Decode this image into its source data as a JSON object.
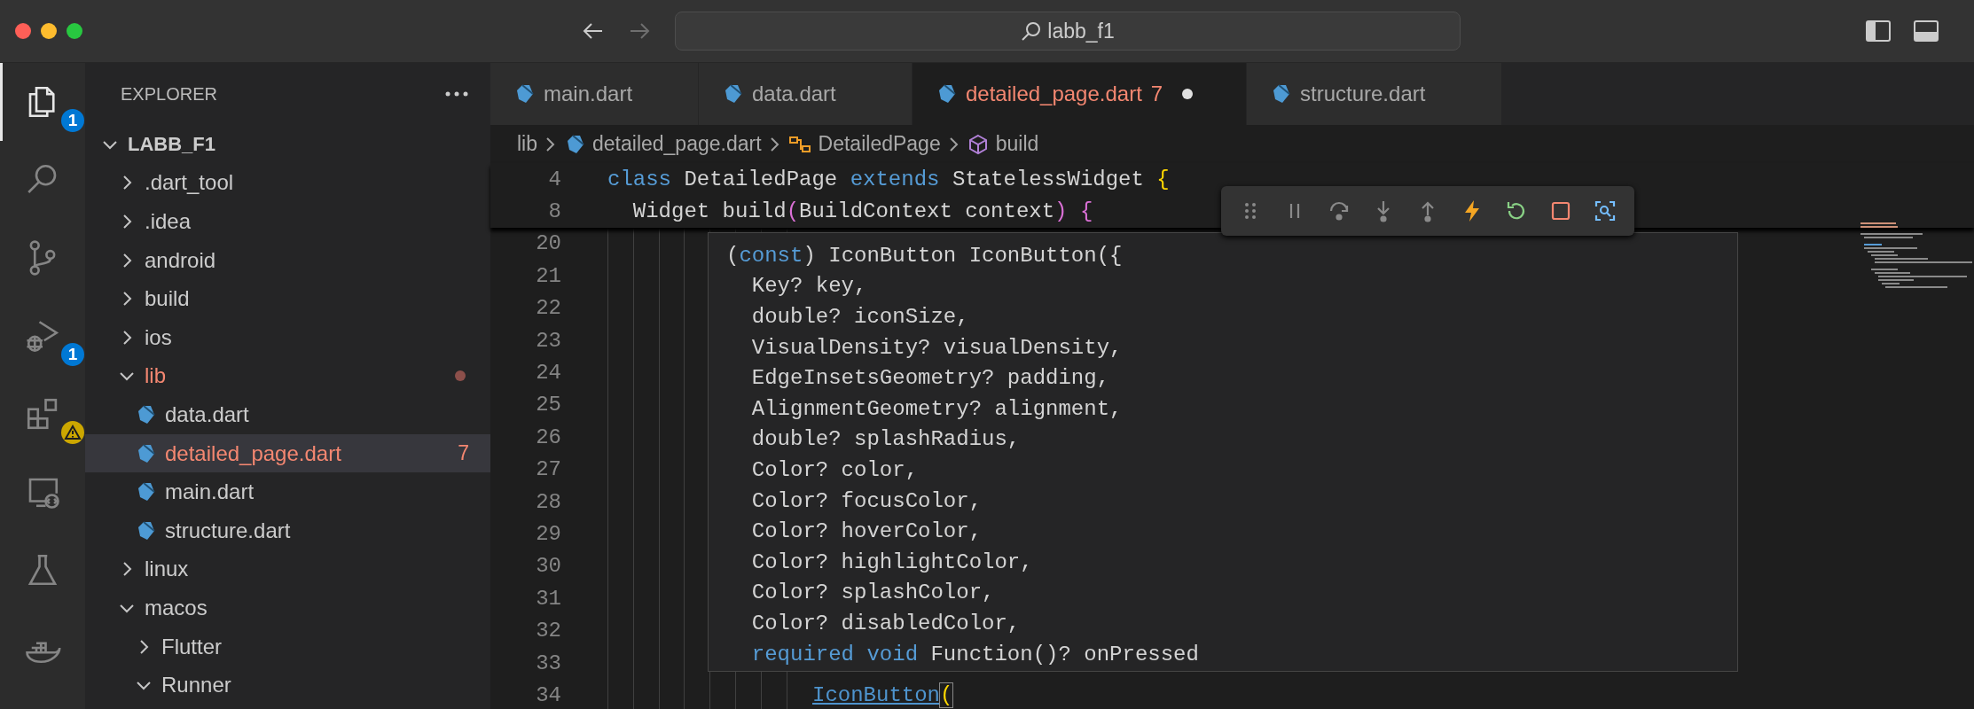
{
  "window": {
    "title": "labb_f1"
  },
  "activity_bar": [
    {
      "kind": "explorer",
      "selected": true,
      "badge": "1"
    },
    {
      "kind": "search",
      "selected": false
    },
    {
      "kind": "source-control",
      "selected": false
    },
    {
      "kind": "run-debug",
      "selected": false,
      "badge": "1"
    },
    {
      "kind": "extensions",
      "selected": false,
      "warning": true
    },
    {
      "kind": "remote",
      "selected": false
    },
    {
      "kind": "testing",
      "selected": false
    },
    {
      "kind": "docker",
      "selected": false
    }
  ],
  "sidebar": {
    "title": "EXPLORER",
    "tree": [
      {
        "label": "LABB_F1",
        "kind": "folder",
        "expanded": true,
        "selected": false,
        "children": [
          {
            "label": ".dart_tool",
            "kind": "folder",
            "expanded": false,
            "selected": false
          },
          {
            "label": ".idea",
            "kind": "folder",
            "expanded": false,
            "selected": false
          },
          {
            "label": "android",
            "kind": "folder",
            "expanded": false,
            "selected": false
          },
          {
            "label": "build",
            "kind": "folder",
            "expanded": false,
            "selected": false
          },
          {
            "label": "ios",
            "kind": "folder",
            "expanded": false,
            "selected": false
          },
          {
            "label": "lib",
            "kind": "folder",
            "expanded": true,
            "selected": false,
            "problems": true,
            "children": [
              {
                "label": "data.dart",
                "kind": "file",
                "selected": false
              },
              {
                "label": "detailed_page.dart",
                "kind": "file",
                "selected": true,
                "problems": true,
                "badge": "7"
              },
              {
                "label": "main.dart",
                "kind": "file",
                "selected": false
              },
              {
                "label": "structure.dart",
                "kind": "file",
                "selected": false
              }
            ]
          },
          {
            "label": "linux",
            "kind": "folder",
            "expanded": false,
            "selected": false
          },
          {
            "label": "macos",
            "kind": "folder",
            "expanded": true,
            "selected": false,
            "children": [
              {
                "label": "Flutter",
                "kind": "folder",
                "expanded": false,
                "selected": false
              },
              {
                "label": "Runner",
                "kind": "folder",
                "expanded": true,
                "selected": false
              }
            ]
          }
        ]
      }
    ]
  },
  "tabs": [
    {
      "label": "main.dart",
      "selected": false
    },
    {
      "label": "data.dart",
      "selected": false
    },
    {
      "label": "detailed_page.dart",
      "selected": true,
      "problems": true,
      "badge": "7",
      "modified": true
    },
    {
      "label": "structure.dart",
      "selected": false
    }
  ],
  "breadcrumb": [
    {
      "label": "lib",
      "kind": "folder"
    },
    {
      "label": "detailed_page.dart",
      "kind": "file"
    },
    {
      "label": "DetailedPage",
      "kind": "class"
    },
    {
      "label": "build",
      "kind": "method"
    }
  ],
  "debug_toolbar": [
    {
      "kind": "grip"
    },
    {
      "kind": "pause"
    },
    {
      "kind": "step-over"
    },
    {
      "kind": "step-into"
    },
    {
      "kind": "step-out"
    },
    {
      "kind": "hot-reload"
    },
    {
      "kind": "restart"
    },
    {
      "kind": "stop"
    },
    {
      "kind": "inspect"
    }
  ],
  "sticky_lines": [
    {
      "number": "4",
      "tokens": [
        {
          "text": "class",
          "kind": "keyword"
        },
        {
          "text": " DetailedPage ",
          "kind": "plain"
        },
        {
          "text": "extends",
          "kind": "keyword"
        },
        {
          "text": " StatelessWidget ",
          "kind": "plain"
        },
        {
          "text": "{",
          "kind": "bracket1"
        }
      ]
    },
    {
      "number": "8",
      "tokens": [
        {
          "text": "  Widget build",
          "kind": "plain"
        },
        {
          "text": "(",
          "kind": "bracket2"
        },
        {
          "text": "BuildContext context",
          "kind": "plain"
        },
        {
          "text": ")",
          "kind": "bracket2"
        },
        {
          "text": " {",
          "kind": "bracket2"
        }
      ]
    }
  ],
  "code_lines": [
    {
      "number": "20"
    },
    {
      "number": "21"
    },
    {
      "number": "22"
    },
    {
      "number": "23"
    },
    {
      "number": "24"
    },
    {
      "number": "25"
    },
    {
      "number": "26"
    },
    {
      "number": "27"
    },
    {
      "number": "28"
    },
    {
      "number": "29"
    },
    {
      "number": "30"
    },
    {
      "number": "31"
    },
    {
      "number": "32"
    },
    {
      "number": "33"
    },
    {
      "number": "34",
      "tokens": [
        {
          "text": "IconButton",
          "kind": "link"
        },
        {
          "text": "(",
          "kind": "bracket-match"
        }
      ]
    }
  ],
  "hover": {
    "lines": [
      [
        {
          "text": "(",
          "kind": "plain"
        },
        {
          "text": "const",
          "kind": "keyword"
        },
        {
          "text": ") IconButton IconButton({",
          "kind": "plain"
        }
      ],
      [
        {
          "text": "  Key? key,",
          "kind": "plain"
        }
      ],
      [
        {
          "text": "  double? iconSize,",
          "kind": "plain"
        }
      ],
      [
        {
          "text": "  VisualDensity? visualDensity,",
          "kind": "plain"
        }
      ],
      [
        {
          "text": "  EdgeInsetsGeometry? padding,",
          "kind": "plain"
        }
      ],
      [
        {
          "text": "  AlignmentGeometry? alignment,",
          "kind": "plain"
        }
      ],
      [
        {
          "text": "  double? splashRadius,",
          "kind": "plain"
        }
      ],
      [
        {
          "text": "  Color? color,",
          "kind": "plain"
        }
      ],
      [
        {
          "text": "  Color? focusColor,",
          "kind": "plain"
        }
      ],
      [
        {
          "text": "  Color? hoverColor,",
          "kind": "plain"
        }
      ],
      [
        {
          "text": "  Color? highlightColor,",
          "kind": "plain"
        }
      ],
      [
        {
          "text": "  Color? splashColor,",
          "kind": "plain"
        }
      ],
      [
        {
          "text": "  Color? disabledColor,",
          "kind": "plain"
        }
      ],
      [
        {
          "text": "  required void",
          "kind": "keyword"
        },
        {
          "text": " Function()? onPressed",
          "kind": "plain"
        }
      ]
    ]
  }
}
